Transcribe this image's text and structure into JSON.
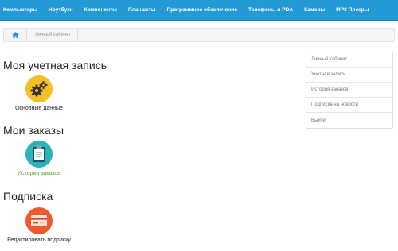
{
  "nav": {
    "items": [
      "Компьютеры",
      "Ноутбуки",
      "Компоненты",
      "Планшеты",
      "Программное обеспечение",
      "Телефоны и PDA",
      "Камеры",
      "MP3 Плееры"
    ],
    "bg_color": "#239ad6"
  },
  "breadcrumb": {
    "home_icon": "home-icon",
    "current": "Личный кабинет"
  },
  "sections": {
    "account": {
      "title": "Моя учетная запись",
      "tile": {
        "label": "Основные данные",
        "icon": "gears-icon",
        "icon_color": "#f5c026"
      }
    },
    "orders": {
      "title": "Мои заказы",
      "tile": {
        "label": "История заказов",
        "icon": "clipboard-icon",
        "icon_color": "#2bb3b9"
      }
    },
    "subscription": {
      "title": "Подписка",
      "tile": {
        "label": "Редактировать подписку",
        "icon": "card-icon",
        "icon_color": "#ee5a2e"
      }
    }
  },
  "sidebar": {
    "items": [
      "Личный кабинет",
      "Учетная запись",
      "История заказов",
      "Подписка на новости",
      "Выйти"
    ]
  }
}
